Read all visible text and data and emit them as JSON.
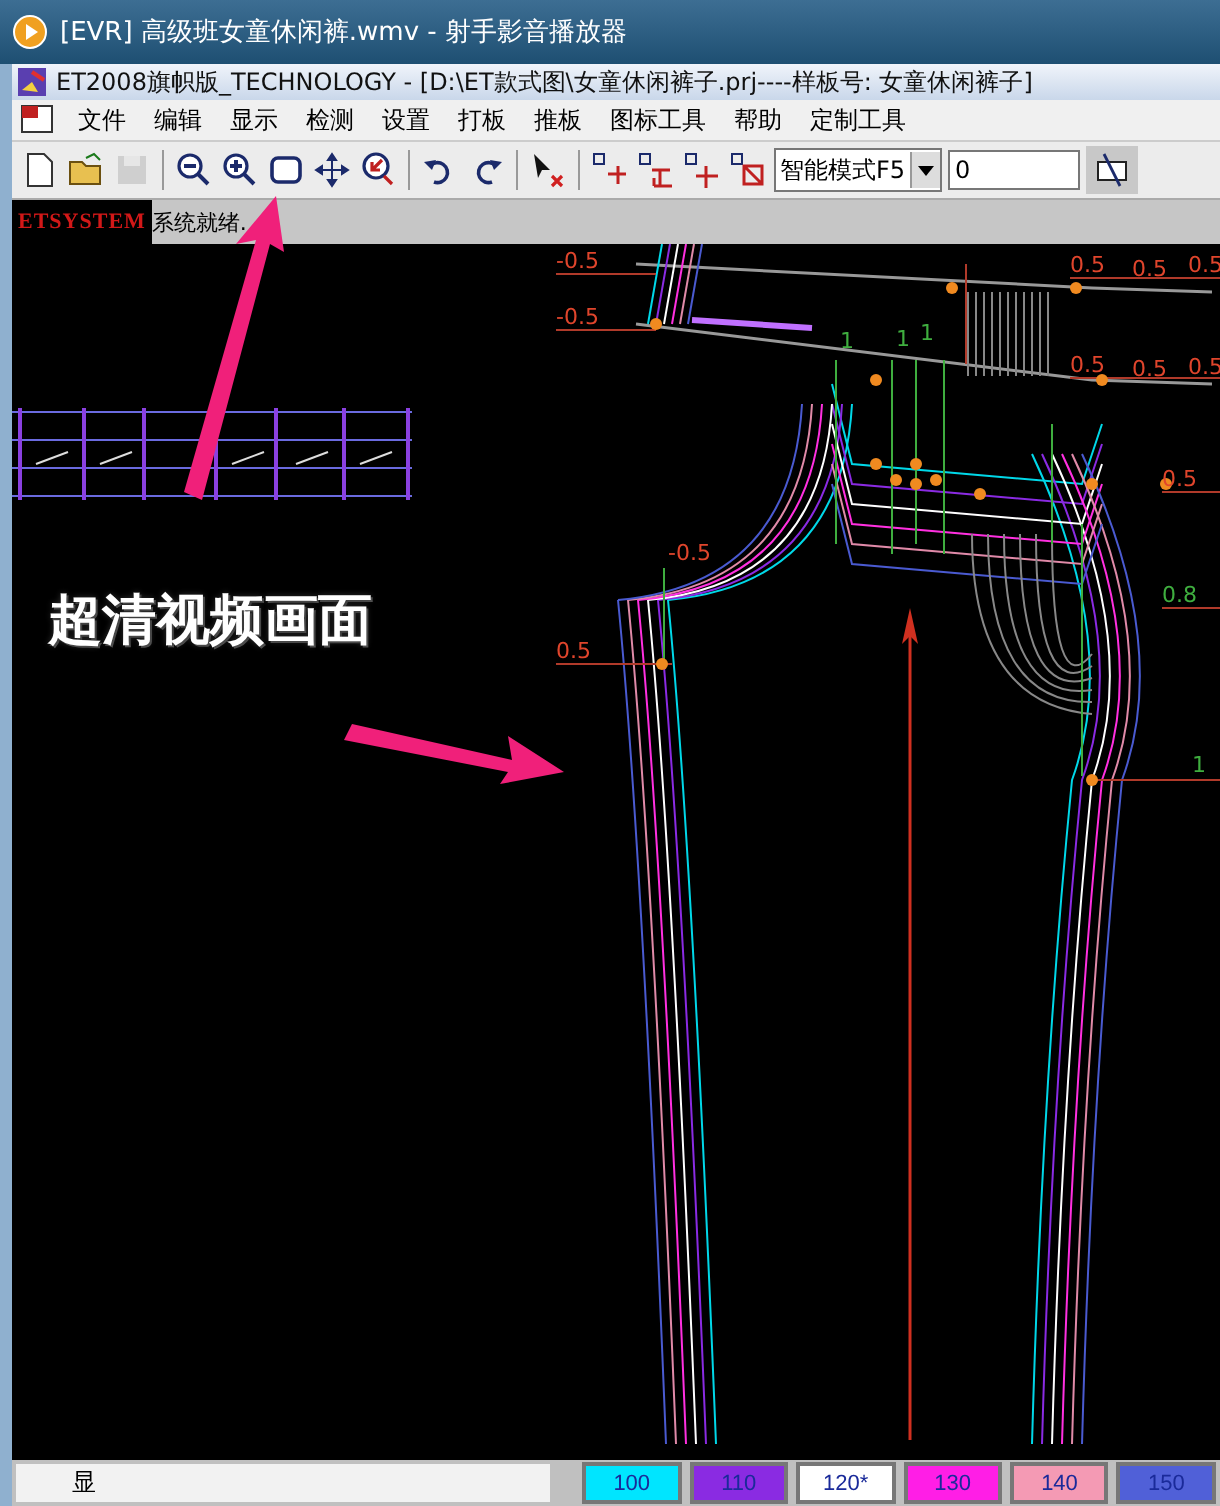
{
  "player_title": "[EVR] 高级班女童休闲裤.wmv - 射手影音播放器",
  "window_title": "ET2008旗帜版_TECHNOLOGY - [D:\\ET款式图\\女童休闲裤子.prj----样板号: 女童休闲裤子]",
  "menu": [
    "文件",
    "编辑",
    "显示",
    "检测",
    "设置",
    "打板",
    "推板",
    "图标工具",
    "帮助",
    "定制工具"
  ],
  "tool_groups": [
    [
      {
        "kind": "new",
        "disabled": false
      },
      {
        "kind": "open",
        "disabled": false
      },
      {
        "kind": "save",
        "disabled": true
      }
    ],
    [
      {
        "kind": "zoom-out",
        "disabled": false
      },
      {
        "kind": "zoom-in",
        "disabled": false
      },
      {
        "kind": "fit",
        "disabled": false
      },
      {
        "kind": "pan",
        "disabled": false
      },
      {
        "kind": "zoom-back",
        "disabled": false
      }
    ],
    [
      {
        "kind": "undo",
        "disabled": false
      },
      {
        "kind": "redo",
        "disabled": false
      }
    ],
    [
      {
        "kind": "pick-delete",
        "disabled": false
      }
    ],
    [
      {
        "kind": "point-move",
        "disabled": false
      },
      {
        "kind": "point-align",
        "disabled": false
      },
      {
        "kind": "point-add",
        "disabled": false
      },
      {
        "kind": "point-remove",
        "disabled": false
      }
    ]
  ],
  "mode_select": "智能模式F5",
  "value_field": "0",
  "status": {
    "logo": "ETSYSTEM",
    "message": "系统就绪."
  },
  "canvas": {
    "overlay_caption": "超清视频画面",
    "dimension_labels": [
      {
        "text": "-0.5",
        "color": "#e0452c"
      },
      {
        "text": "-0.5",
        "color": "#e0452c"
      },
      {
        "text": "0.5",
        "color": "#e0452c"
      },
      {
        "text": "0.5",
        "color": "#e0452c"
      },
      {
        "text": "0.5",
        "color": "#e0452c"
      },
      {
        "text": "0.5",
        "color": "#e0452c"
      },
      {
        "text": "0.5",
        "color": "#e0452c"
      },
      {
        "text": "0.5",
        "color": "#e0452c"
      },
      {
        "text": "0.5",
        "color": "#e0452c"
      },
      {
        "text": "0.8",
        "color": "#3fae3f"
      },
      {
        "text": "-0.5",
        "color": "#e0452c"
      },
      {
        "text": "0.5",
        "color": "#e0452c"
      },
      {
        "text": "1",
        "color": "#3fae3f"
      },
      {
        "text": "1",
        "color": "#3fae3f"
      },
      {
        "text": "1",
        "color": "#3fae3f"
      },
      {
        "text": "1",
        "color": "#3fae3f"
      }
    ]
  },
  "bottom_bar": {
    "status_text": "显",
    "sizes": [
      {
        "label": "100",
        "color": "#00e5ff"
      },
      {
        "label": "110",
        "color": "#8a2be2"
      },
      {
        "label": "120*",
        "color": "#ffffff"
      },
      {
        "label": "130",
        "color": "#ff1ee6"
      },
      {
        "label": "140",
        "color": "#f49ab4"
      },
      {
        "label": "150",
        "color": "#5060d8"
      }
    ]
  }
}
